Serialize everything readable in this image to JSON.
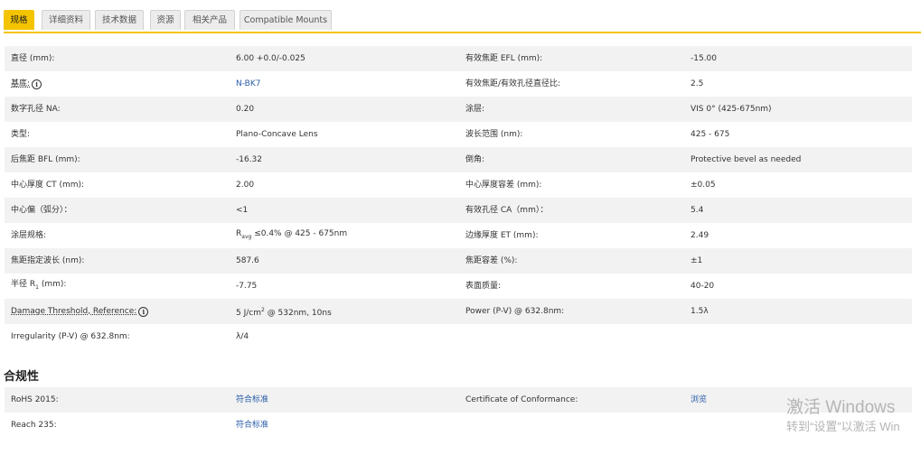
{
  "tabs": [
    "规格",
    "详细资料",
    "技术数据",
    "资源",
    "相关产品",
    "Compatible Mounts"
  ],
  "specs": [
    {
      "l1": "直径 (mm):",
      "v1": "6.00 +0.0/-0.025",
      "l2": "有效焦距 EFL (mm):",
      "v2": "-15.00"
    },
    {
      "l1": "基底:",
      "v1": "N-BK7",
      "l2": "有效焦距/有效孔径直径比:",
      "v2": "2.5"
    },
    {
      "l1": "数字孔径 NA:",
      "v1": "0.20",
      "l2": "涂层:",
      "v2": "VIS 0° (425-675nm)"
    },
    {
      "l1": "类型:",
      "v1": "Plano-Concave Lens",
      "l2": "波长范围 (nm):",
      "v2": "425 - 675"
    },
    {
      "l1": "后焦距 BFL (mm):",
      "v1": "-16.32",
      "l2": "倒角:",
      "v2": "Protective bevel as needed"
    },
    {
      "l1": "中心厚度 CT (mm):",
      "v1": "2.00",
      "l2": "中心厚度容差 (mm):",
      "v2": "±0.05"
    },
    {
      "l1": "中心偏（弧分）：",
      "v1": "<1",
      "l2": "有效孔径 CA（mm）：",
      "v2": "5.4"
    },
    {
      "l1": "涂层规格:",
      "v1_prefix": "R",
      "v1_sub": "avg",
      "v1": "≤0.4% @ 425 - 675nm",
      "l2": "边缘厚度 ET (mm):",
      "v2": "2.49"
    },
    {
      "l1": "焦距指定波长 (nm):",
      "v1": "587.6",
      "l2": "焦距容差 (%):",
      "v2": "±1"
    },
    {
      "l1_prefix": "半径 R",
      "l1_sub": "1",
      "l1": " (mm):",
      "v1": "-7.75",
      "l2": "表面质量:",
      "v2": "40-20"
    },
    {
      "l1": "Damage Threshold, Reference:",
      "v1_prefix": "5 J/cm",
      "v1_sup": "2",
      "v1": " @ 532nm, 10ns",
      "l2": "Power (P-V) @ 632.8nm:",
      "v2": "1.5λ"
    },
    {
      "l1": "Irregularity (P-V) @ 632.8nm:",
      "v1": "λ/4",
      "l2": "",
      "v2": ""
    }
  ],
  "info_icon_glyph": "i",
  "compliance_title": "合规性",
  "compliance": [
    {
      "l1": "RoHS 2015:",
      "v1": "符合标准",
      "l2": "Certificate of Conformance:",
      "v2": "浏览"
    },
    {
      "l1": "Reach 235:",
      "v1": "符合标准",
      "l2": "",
      "v2": ""
    }
  ],
  "watermark": {
    "line1": "激活 Windows",
    "line2": "转到“设置”以激活 Win"
  },
  "colors": {
    "accent": "#f5c400",
    "link": "#2a5ea8",
    "row_shade": "#f2f2f2"
  }
}
